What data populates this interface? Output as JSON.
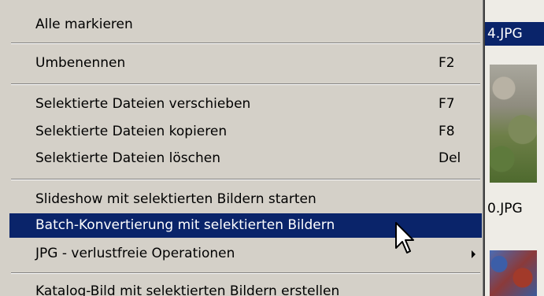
{
  "background": {
    "file_a": "4.JPG",
    "file_b": "0.JPG"
  },
  "menu": {
    "items": [
      {
        "label": "Alle markieren",
        "shortcut": ""
      },
      {
        "label": "Umbenennen",
        "shortcut": "F2"
      },
      {
        "label": "Selektierte Dateien verschieben",
        "shortcut": "F7"
      },
      {
        "label": "Selektierte Dateien kopieren",
        "shortcut": "F8"
      },
      {
        "label": "Selektierte Dateien löschen",
        "shortcut": "Del"
      },
      {
        "label": "Slideshow mit selektierten Bildern starten",
        "shortcut": ""
      },
      {
        "label": "Batch-Konvertierung mit selektierten Bildern",
        "shortcut": "",
        "selected": true
      },
      {
        "label": "JPG - verlustfreie Operationen",
        "shortcut": "",
        "submenu": true
      },
      {
        "label": "Katalog-Bild mit selektierten Bildern erstellen",
        "shortcut": ""
      }
    ]
  },
  "colors": {
    "menu_bg": "#d4d0c8",
    "highlight": "#0a246a",
    "highlight_text": "#ffffff"
  },
  "icons": {
    "cursor": "arrow-cursor-icon",
    "submenu": "submenu-arrow-icon"
  }
}
